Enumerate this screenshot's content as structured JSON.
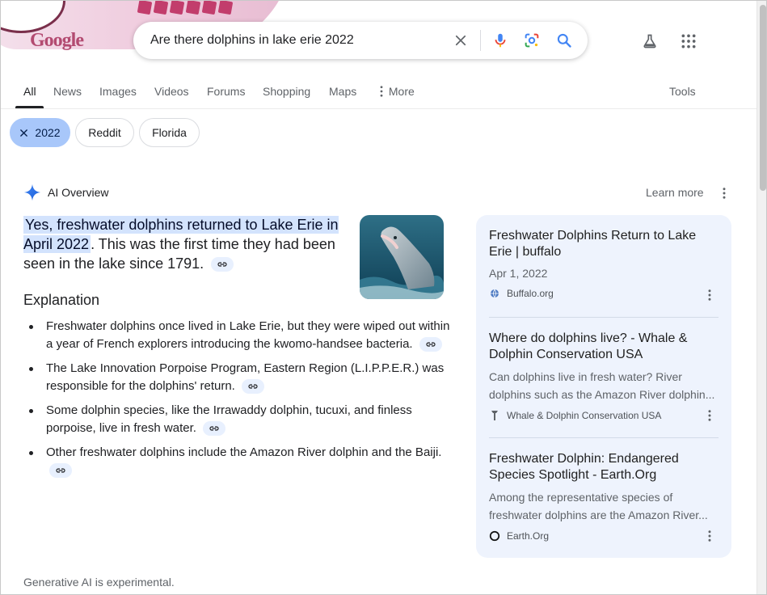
{
  "search": {
    "query": "Are there dolphins in lake erie 2022"
  },
  "logo": {
    "text": "Google"
  },
  "tabs": [
    {
      "label": "All"
    },
    {
      "label": "News"
    },
    {
      "label": "Images"
    },
    {
      "label": "Videos"
    },
    {
      "label": "Forums"
    },
    {
      "label": "Shopping"
    },
    {
      "label": "Maps"
    },
    {
      "label": "More"
    }
  ],
  "tools_label": "Tools",
  "chips": [
    {
      "label": "2022",
      "selected": true
    },
    {
      "label": "Reddit"
    },
    {
      "label": "Florida"
    }
  ],
  "ai_overview": {
    "title": "AI Overview",
    "learn_more": "Learn more",
    "lead_highlight": "Yes, freshwater dolphins returned to Lake Erie in April 2022",
    "lead_rest": ". This was the first time they had been seen in the lake since 1791.",
    "explanation_heading": "Explanation",
    "bullets": [
      "Freshwater dolphins once lived in Lake Erie, but they were wiped out within a year of French explorers introducing the kwomo-handsee bacteria.",
      "The Lake Innovation Porpoise Program, Eastern Region (L.I.P.P.E.R.) was responsible for the dolphins' return.",
      "Some dolphin species, like the Irrawaddy dolphin, tucuxi, and finless porpoise, live in fresh water.",
      "Other freshwater dolphins include the Amazon River dolphin and the Baiji."
    ],
    "footer": "Generative AI is experimental."
  },
  "sources": [
    {
      "title": "Freshwater Dolphins Return to Lake Erie | buffalo",
      "date": "Apr 1, 2022",
      "site": "Buffalo.org"
    },
    {
      "title": "Where do dolphins live? - Whale & Dolphin Conservation USA",
      "snippet": "Can dolphins live in fresh water? River dolphins such as the Amazon River dolphin...",
      "site": "Whale & Dolphin Conservation USA"
    },
    {
      "title": "Freshwater Dolphin: Endangered Species Spotlight - Earth.Org",
      "snippet1": "Among the representative species of",
      "snippet2": "freshwater dolphins are the Amazon River...",
      "site": "Earth.Org"
    }
  ],
  "colors": {
    "accent": "#1a73e8",
    "highlight": "#d3e3fd",
    "chip_selected": "#a8c7fa",
    "card_bg": "#eef3fd"
  }
}
